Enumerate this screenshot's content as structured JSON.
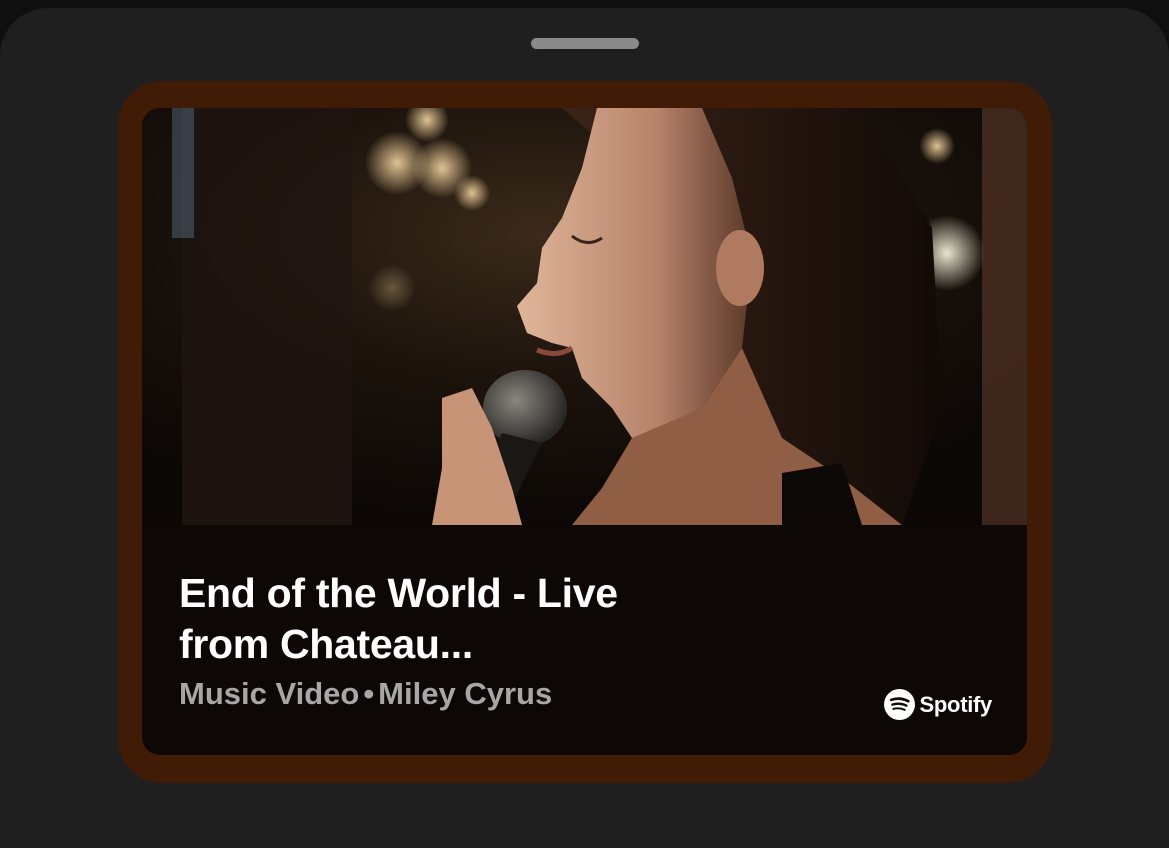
{
  "track": {
    "title": "End of the World - Live from Chateau...",
    "type": "Music Video",
    "separator": "•",
    "artist": "Miley Cyrus"
  },
  "brand": {
    "name": "Spotify",
    "icon": "spotify-logo-icon"
  },
  "colors": {
    "sheet_background": "#1f1f1f",
    "card_frame": "#401c06",
    "card_background": "#0d0806",
    "title_text": "#ffffff",
    "subtitle_text": "#a7a7a7"
  },
  "media": {
    "description_icon": "music-video-thumbnail"
  }
}
